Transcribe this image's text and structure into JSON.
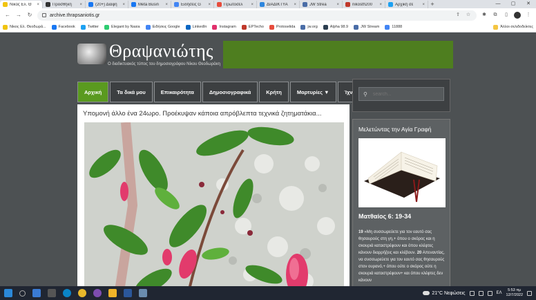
{
  "browser": {
    "tabs": [
      {
        "label": "Νίκος Ελ. Θ",
        "color": "#f1c40f",
        "active": true
      },
      {
        "label": "Προσθήκη",
        "color": "#333333"
      },
      {
        "label": "(20+) Διαφη",
        "color": "#1877f2"
      },
      {
        "label": "Meta Busin",
        "color": "#1877f2"
      },
      {
        "label": "Ειδήσεις G",
        "color": "#4285f4"
      },
      {
        "label": "Πρωτοσέλ",
        "color": "#e74c3c"
      },
      {
        "label": "ΔΙΑΔΙΚΤΥΑ",
        "color": "#2e86de"
      },
      {
        "label": "JW Strea",
        "color": "#4a6da7"
      },
      {
        "label": "nikosth200",
        "color": "#c0392b"
      },
      {
        "label": "Αρχική σε",
        "color": "#1da1f2"
      }
    ],
    "new_tab": "+",
    "url": "archive.thrapsaniotis.gr",
    "bookmarks": [
      {
        "label": "Νίκος Ελ. Θεοδωρά...",
        "color": "#f1c40f"
      },
      {
        "label": "Facebook",
        "color": "#1877f2"
      },
      {
        "label": "Twitter",
        "color": "#1da1f2"
      },
      {
        "label": "Elegant by Nasia",
        "color": "#2ecc71"
      },
      {
        "label": "Ειδήσεις Google",
        "color": "#4285f4"
      },
      {
        "label": "LinkedIn",
        "color": "#0a66c2"
      },
      {
        "label": "Instagram",
        "color": "#e1306c"
      },
      {
        "label": "EPTecho",
        "color": "#c0392b"
      },
      {
        "label": "Protoselida",
        "color": "#e74c3c"
      },
      {
        "label": "jw.org",
        "color": "#4a6da7"
      },
      {
        "label": "Alpha 98.9",
        "color": "#2c3e50"
      },
      {
        "label": "JW Stream",
        "color": "#4a6da7"
      },
      {
        "label": "11888",
        "color": "#4285f4"
      }
    ],
    "other_bookmarks": "Άλλοι σελιδοδείκτες"
  },
  "site": {
    "title": "Θραψανιώτης",
    "subtitle": "Ο διαδικτυακός τύπος του δημοσιογράφου Νίκου Θεοδωράκη",
    "nav": [
      {
        "label": "Αρχική",
        "active": true
      },
      {
        "label": "Τα δικά μου"
      },
      {
        "label": "Επικαιρότητα"
      },
      {
        "label": "Δημοσιογραφικά"
      },
      {
        "label": "Κρήτη"
      },
      {
        "label": "Μαρτυρίες ▼"
      },
      {
        "label": "Ίχνη Ζωής"
      }
    ],
    "post_title": "Υπομονή άλλο ένα 24ωρο. Προέκυψαν κάποια απρόβλεπτα τεχνικά ζητηματάκια...",
    "search_placeholder": "search...",
    "widget_title": "Μελετώντας την Αγία Γραφή",
    "verse_ref": "Ματθαίος 6: 19-34",
    "verse_n1": "19",
    "verse_t1": "»Μη συσσωρεύετε για τον εαυτό σας θησαυρούς στη γη,+ όπου ο σκόρος και η σκουριά καταστρέφουν και όπου κλέφτες κάνουν διαρρήξεις και κλέβουν.",
    "verse_n2": "20",
    "verse_t2": "Απεναντίας, να συσσωρεύετε για τον εαυτό σας θησαυρούς στον ουρανό,+ όπου ούτε ο σκόρος ούτε η σκουριά καταστρέφουν+ και όπου κλέφτες δεν κάνουν"
  },
  "taskbar": {
    "weather": "21°C  Νεφώσεις",
    "lang": "ΕΛ",
    "time": "5:53 πμ",
    "date": "12/7/2022"
  }
}
